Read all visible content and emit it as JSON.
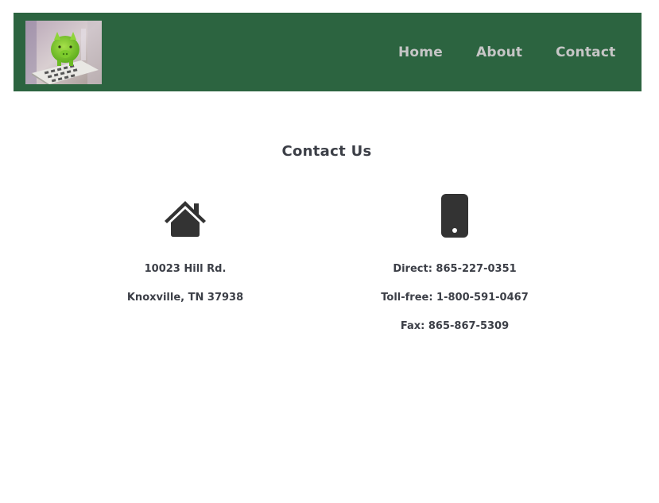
{
  "nav": {
    "items": [
      {
        "label": "Home"
      },
      {
        "label": "About"
      },
      {
        "label": "Contact"
      }
    ]
  },
  "page": {
    "title": "Contact Us"
  },
  "address": {
    "icon": "house-icon",
    "line1": "10023 Hill Rd.",
    "line2": "Knoxville, TN 37938"
  },
  "phone": {
    "icon": "mobile-phone-icon",
    "direct": "Direct: 865-227-0351",
    "tollfree": "Toll-free: 1-800-591-0467",
    "fax": "Fax: 865-867-5309"
  },
  "colors": {
    "header_bg": "#2c6440",
    "nav_text": "#c6c6c6",
    "body_text": "#3c3f47"
  }
}
